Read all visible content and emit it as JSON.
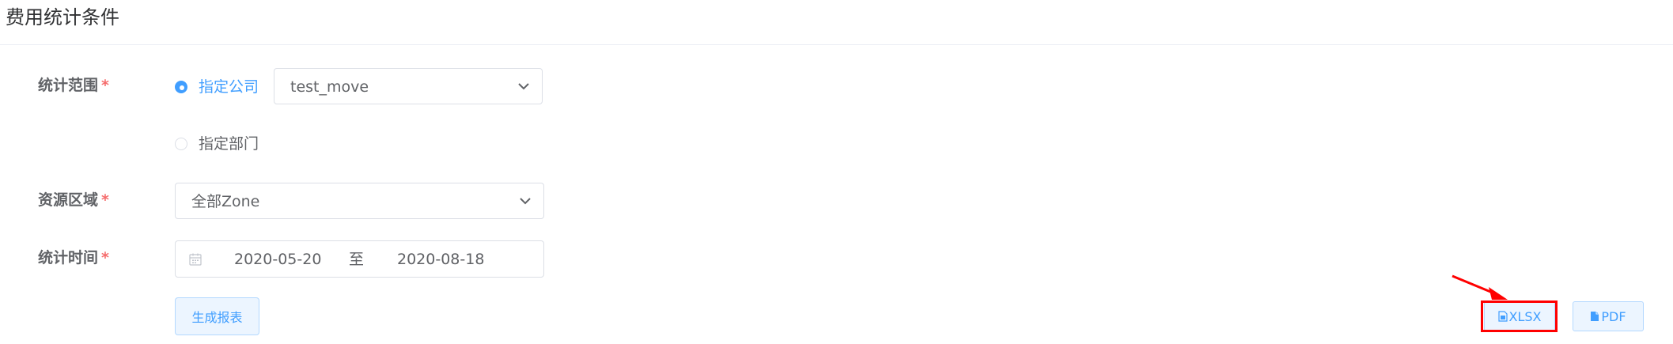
{
  "page_title": "费用统计条件",
  "form": {
    "scope": {
      "label": "统计范围",
      "required_mark": "*",
      "options": [
        {
          "label": "指定公司",
          "checked": true
        },
        {
          "label": "指定部门",
          "checked": false
        }
      ],
      "company_select_value": "test_move"
    },
    "region": {
      "label": "资源区域",
      "required_mark": "*",
      "select_value": "全部Zone"
    },
    "time": {
      "label": "统计时间",
      "required_mark": "*",
      "start": "2020-05-20",
      "separator": "至",
      "end": "2020-08-18"
    },
    "generate_button": "生成报表"
  },
  "export": {
    "xlsx_label": "XLSX",
    "pdf_label": "PDF"
  },
  "colors": {
    "primary": "#409eff",
    "required": "#f56c6c",
    "highlight": "#ff0000"
  },
  "icons": {
    "chevron": "chevron-down-icon",
    "calendar": "calendar-icon",
    "xlsx": "xlsx-file-icon",
    "pdf": "pdf-file-icon"
  }
}
